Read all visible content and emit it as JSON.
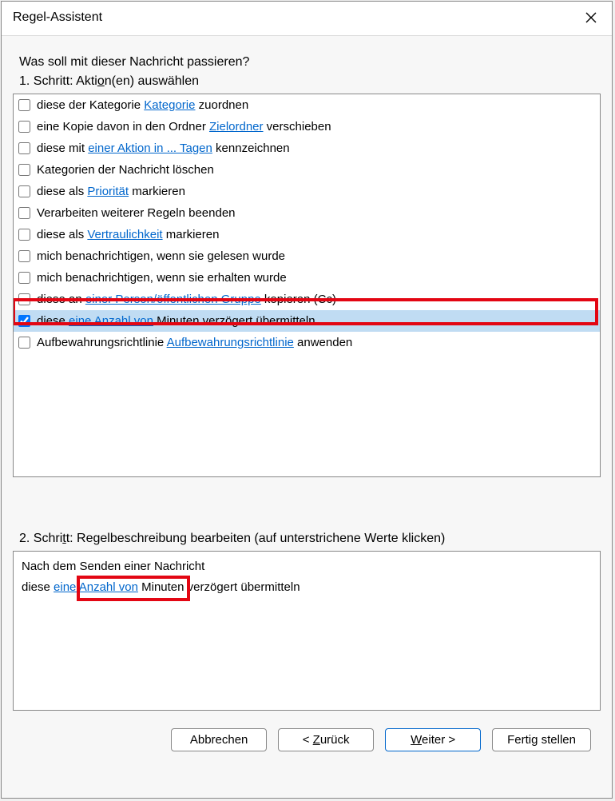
{
  "title": "Regel-Assistent",
  "question": "Was soll mit dieser Nachricht passieren?",
  "step1_prefix": "1. Schritt: Akti",
  "step1_ul": "o",
  "step1_suffix": "n(en) auswählen",
  "items": [
    {
      "pre": "diese der Kategorie ",
      "link": "Kategorie",
      "post": " zuordnen",
      "checked": false
    },
    {
      "pre": "eine Kopie davon in den Ordner ",
      "link": "Zielordner",
      "post": " verschieben",
      "checked": false
    },
    {
      "pre": "diese mit ",
      "link": "einer Aktion in ... Tagen",
      "post": " kennzeichnen",
      "checked": false
    },
    {
      "pre": "Kategorien der Nachricht löschen",
      "link": "",
      "post": "",
      "checked": false
    },
    {
      "pre": "diese als ",
      "link": "Priorität",
      "post": " markieren",
      "checked": false
    },
    {
      "pre": "Verarbeiten weiterer Regeln beenden",
      "link": "",
      "post": "",
      "checked": false
    },
    {
      "pre": "diese als ",
      "link": "Vertraulichkeit",
      "post": " markieren",
      "checked": false
    },
    {
      "pre": "mich benachrichtigen, wenn sie gelesen wurde",
      "link": "",
      "post": "",
      "checked": false
    },
    {
      "pre": "mich benachrichtigen, wenn sie erhalten wurde",
      "link": "",
      "post": "",
      "checked": false
    },
    {
      "pre": "diese an ",
      "link": "einer Person/öffentlichen Gruppe",
      "post": " kopieren (Cc)",
      "checked": false
    },
    {
      "pre": "diese ",
      "link": "eine Anzahl von",
      "post": " Minuten verzögert übermitteln",
      "checked": true
    },
    {
      "pre": "Aufbewahrungsrichtlinie ",
      "link": "Aufbewahrungsrichtlinie",
      "post": " anwenden",
      "checked": false
    }
  ],
  "step2_prefix": "2. Schri",
  "step2_ul": "t",
  "step2_suffix": "t: Regelbeschreibung bearbeiten (auf unterstrichene Werte klicken)",
  "desc_line1": "Nach dem Senden einer Nachricht",
  "desc_line2_pre": "diese ",
  "desc_line2_link": "eine Anzahl von",
  "desc_line2_post": " Minuten verzögert übermitteln",
  "buttons": {
    "cancel": "Abbrechen",
    "back_pre": "< ",
    "back_ul": "Z",
    "back_post": "urück",
    "next_ul": "W",
    "next_post": "eiter >",
    "finish": "Fertig stellen"
  }
}
